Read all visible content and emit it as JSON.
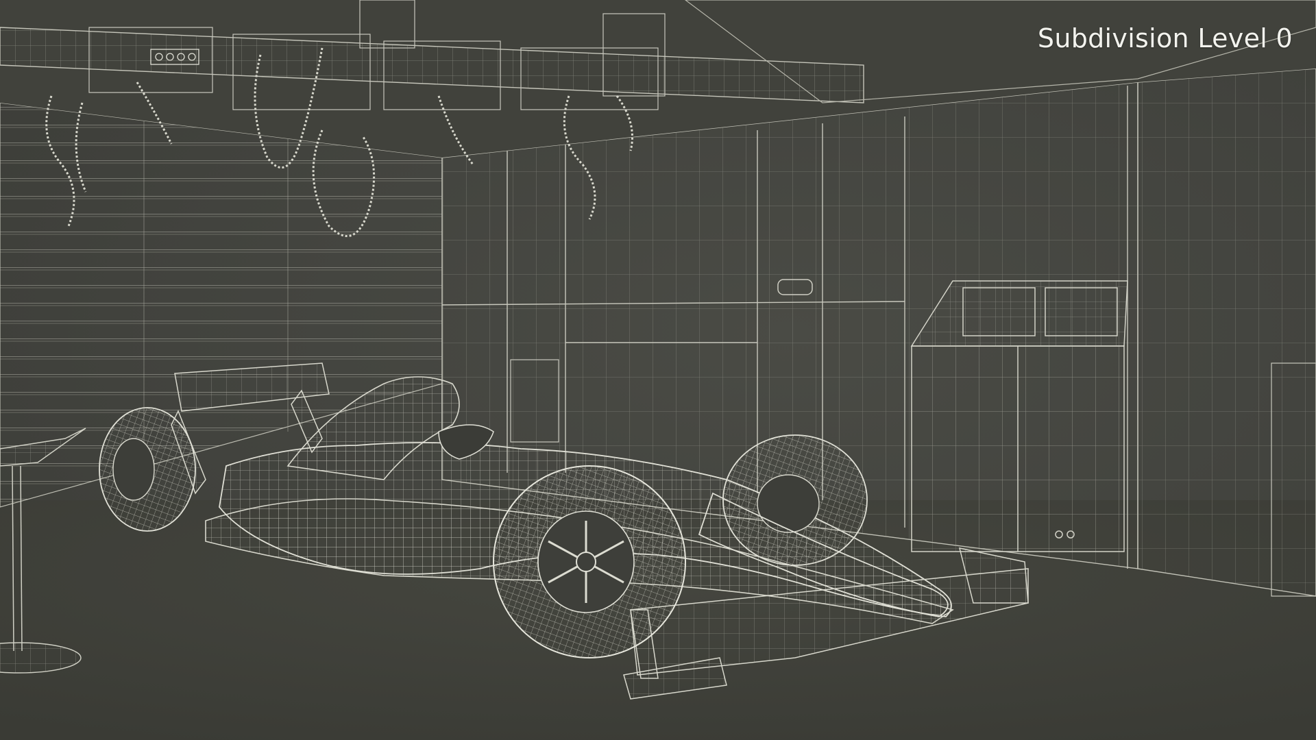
{
  "overlay": {
    "label": "Subdivision Level 0"
  },
  "colors": {
    "background": "#42433e",
    "wire": "#cfcfc4",
    "wire_dim": "#8f8f86",
    "label": "#f3f3ee"
  },
  "scene": {
    "subject": "formula-one-car-wireframe",
    "environment": "pit-garage-wireframe"
  }
}
